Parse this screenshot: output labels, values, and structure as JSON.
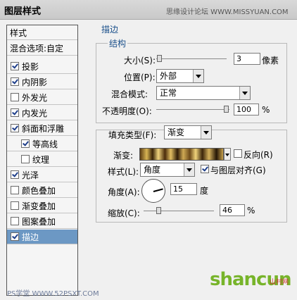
{
  "window": {
    "title": "图层样式",
    "watermark": "思缘设计论坛 WWW.MISSYUAN.COM"
  },
  "sidebar": {
    "header": "样式",
    "blend_options": "混合选项:自定",
    "items": [
      {
        "label": "投影",
        "checked": true
      },
      {
        "label": "内阴影",
        "checked": true
      },
      {
        "label": "外发光",
        "checked": false
      },
      {
        "label": "内发光",
        "checked": true
      },
      {
        "label": "斜面和浮雕",
        "checked": true
      },
      {
        "label": "等高线",
        "checked": true
      },
      {
        "label": "纹理",
        "checked": false
      },
      {
        "label": "光泽",
        "checked": true
      },
      {
        "label": "颜色叠加",
        "checked": false
      },
      {
        "label": "渐变叠加",
        "checked": false
      },
      {
        "label": "图案叠加",
        "checked": false
      },
      {
        "label": "描边",
        "checked": true,
        "selected": true
      }
    ]
  },
  "stroke": {
    "section_title": "描边",
    "structure_title": "结构",
    "size_label": "大小(S):",
    "size_value": "3",
    "size_unit": "像素",
    "position_label": "位置(P):",
    "position_value": "外部",
    "blend_mode_label": "混合模式:",
    "blend_mode_value": "正常",
    "opacity_label": "不透明度(O):",
    "opacity_value": "100",
    "opacity_unit": "%",
    "fill_type_label": "填充类型(F):",
    "fill_type_value": "渐变",
    "gradient_label": "渐变:",
    "reverse_label": "反向(R)",
    "reverse_checked": false,
    "style_label": "样式(L):",
    "style_value": "角度",
    "align_label": "与图层对齐(G)",
    "align_checked": true,
    "angle_label": "角度(A):",
    "angle_value": "15",
    "angle_unit": "度",
    "scale_label": "缩放(C):",
    "scale_value": "46",
    "scale_unit": "%"
  },
  "footer": {
    "watermark_left": "PS学堂 WWW.52PSXT.COM",
    "logo_text": "shancun",
    "logo_sub": "山村网"
  }
}
